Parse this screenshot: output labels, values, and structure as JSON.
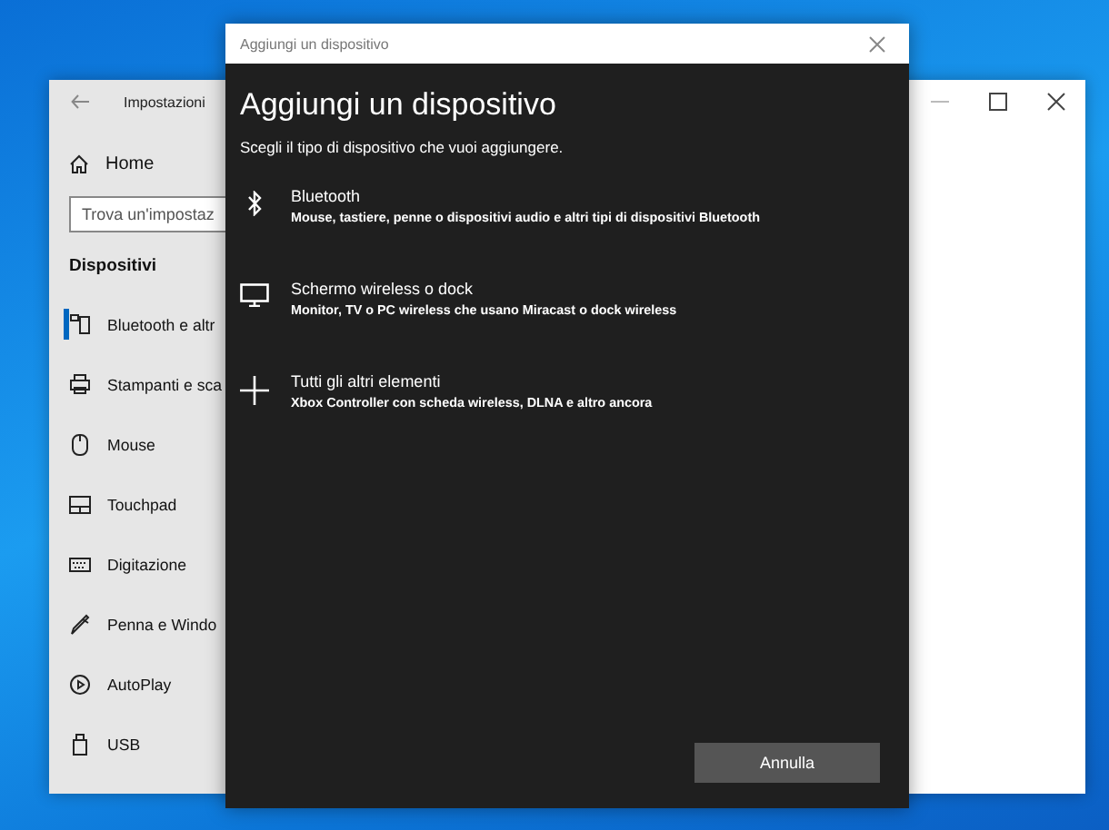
{
  "settings_window": {
    "title": "Impostazioni",
    "home": "Home",
    "search": {
      "placeholder": "Trova un'impostaz"
    },
    "section": "Dispositivi",
    "nav_items": [
      {
        "label": "Bluetooth e altr",
        "kind": "bluetooth",
        "selected": true
      },
      {
        "label": "Stampanti e sca",
        "kind": "printer",
        "selected": false
      },
      {
        "label": "Mouse",
        "kind": "mouse",
        "selected": false
      },
      {
        "label": "Touchpad",
        "kind": "touchpad",
        "selected": false
      },
      {
        "label": "Digitazione",
        "kind": "keyboard",
        "selected": false
      },
      {
        "label": "Penna e Windo",
        "kind": "pen",
        "selected": false
      },
      {
        "label": "AutoPlay",
        "kind": "autoplay",
        "selected": false
      },
      {
        "label": "USB",
        "kind": "usb",
        "selected": false
      }
    ]
  },
  "dialog": {
    "title": "Aggiungi un dispositivo",
    "heading": "Aggiungi un dispositivo",
    "subtitle": "Scegli il tipo di dispositivo che vuoi aggiungere.",
    "options": [
      {
        "kind": "bluetooth",
        "title": "Bluetooth",
        "description": "Mouse, tastiere, penne o dispositivi audio e altri tipi di dispositivi Bluetooth"
      },
      {
        "kind": "display",
        "title": "Schermo wireless o dock",
        "description": "Monitor, TV o PC wireless che usano Miracast o dock wireless"
      },
      {
        "kind": "other",
        "title": "Tutti gli altri elementi",
        "description": "Xbox Controller con scheda wireless, DLNA e altro ancora"
      }
    ],
    "cancel_button": "Annulla"
  }
}
